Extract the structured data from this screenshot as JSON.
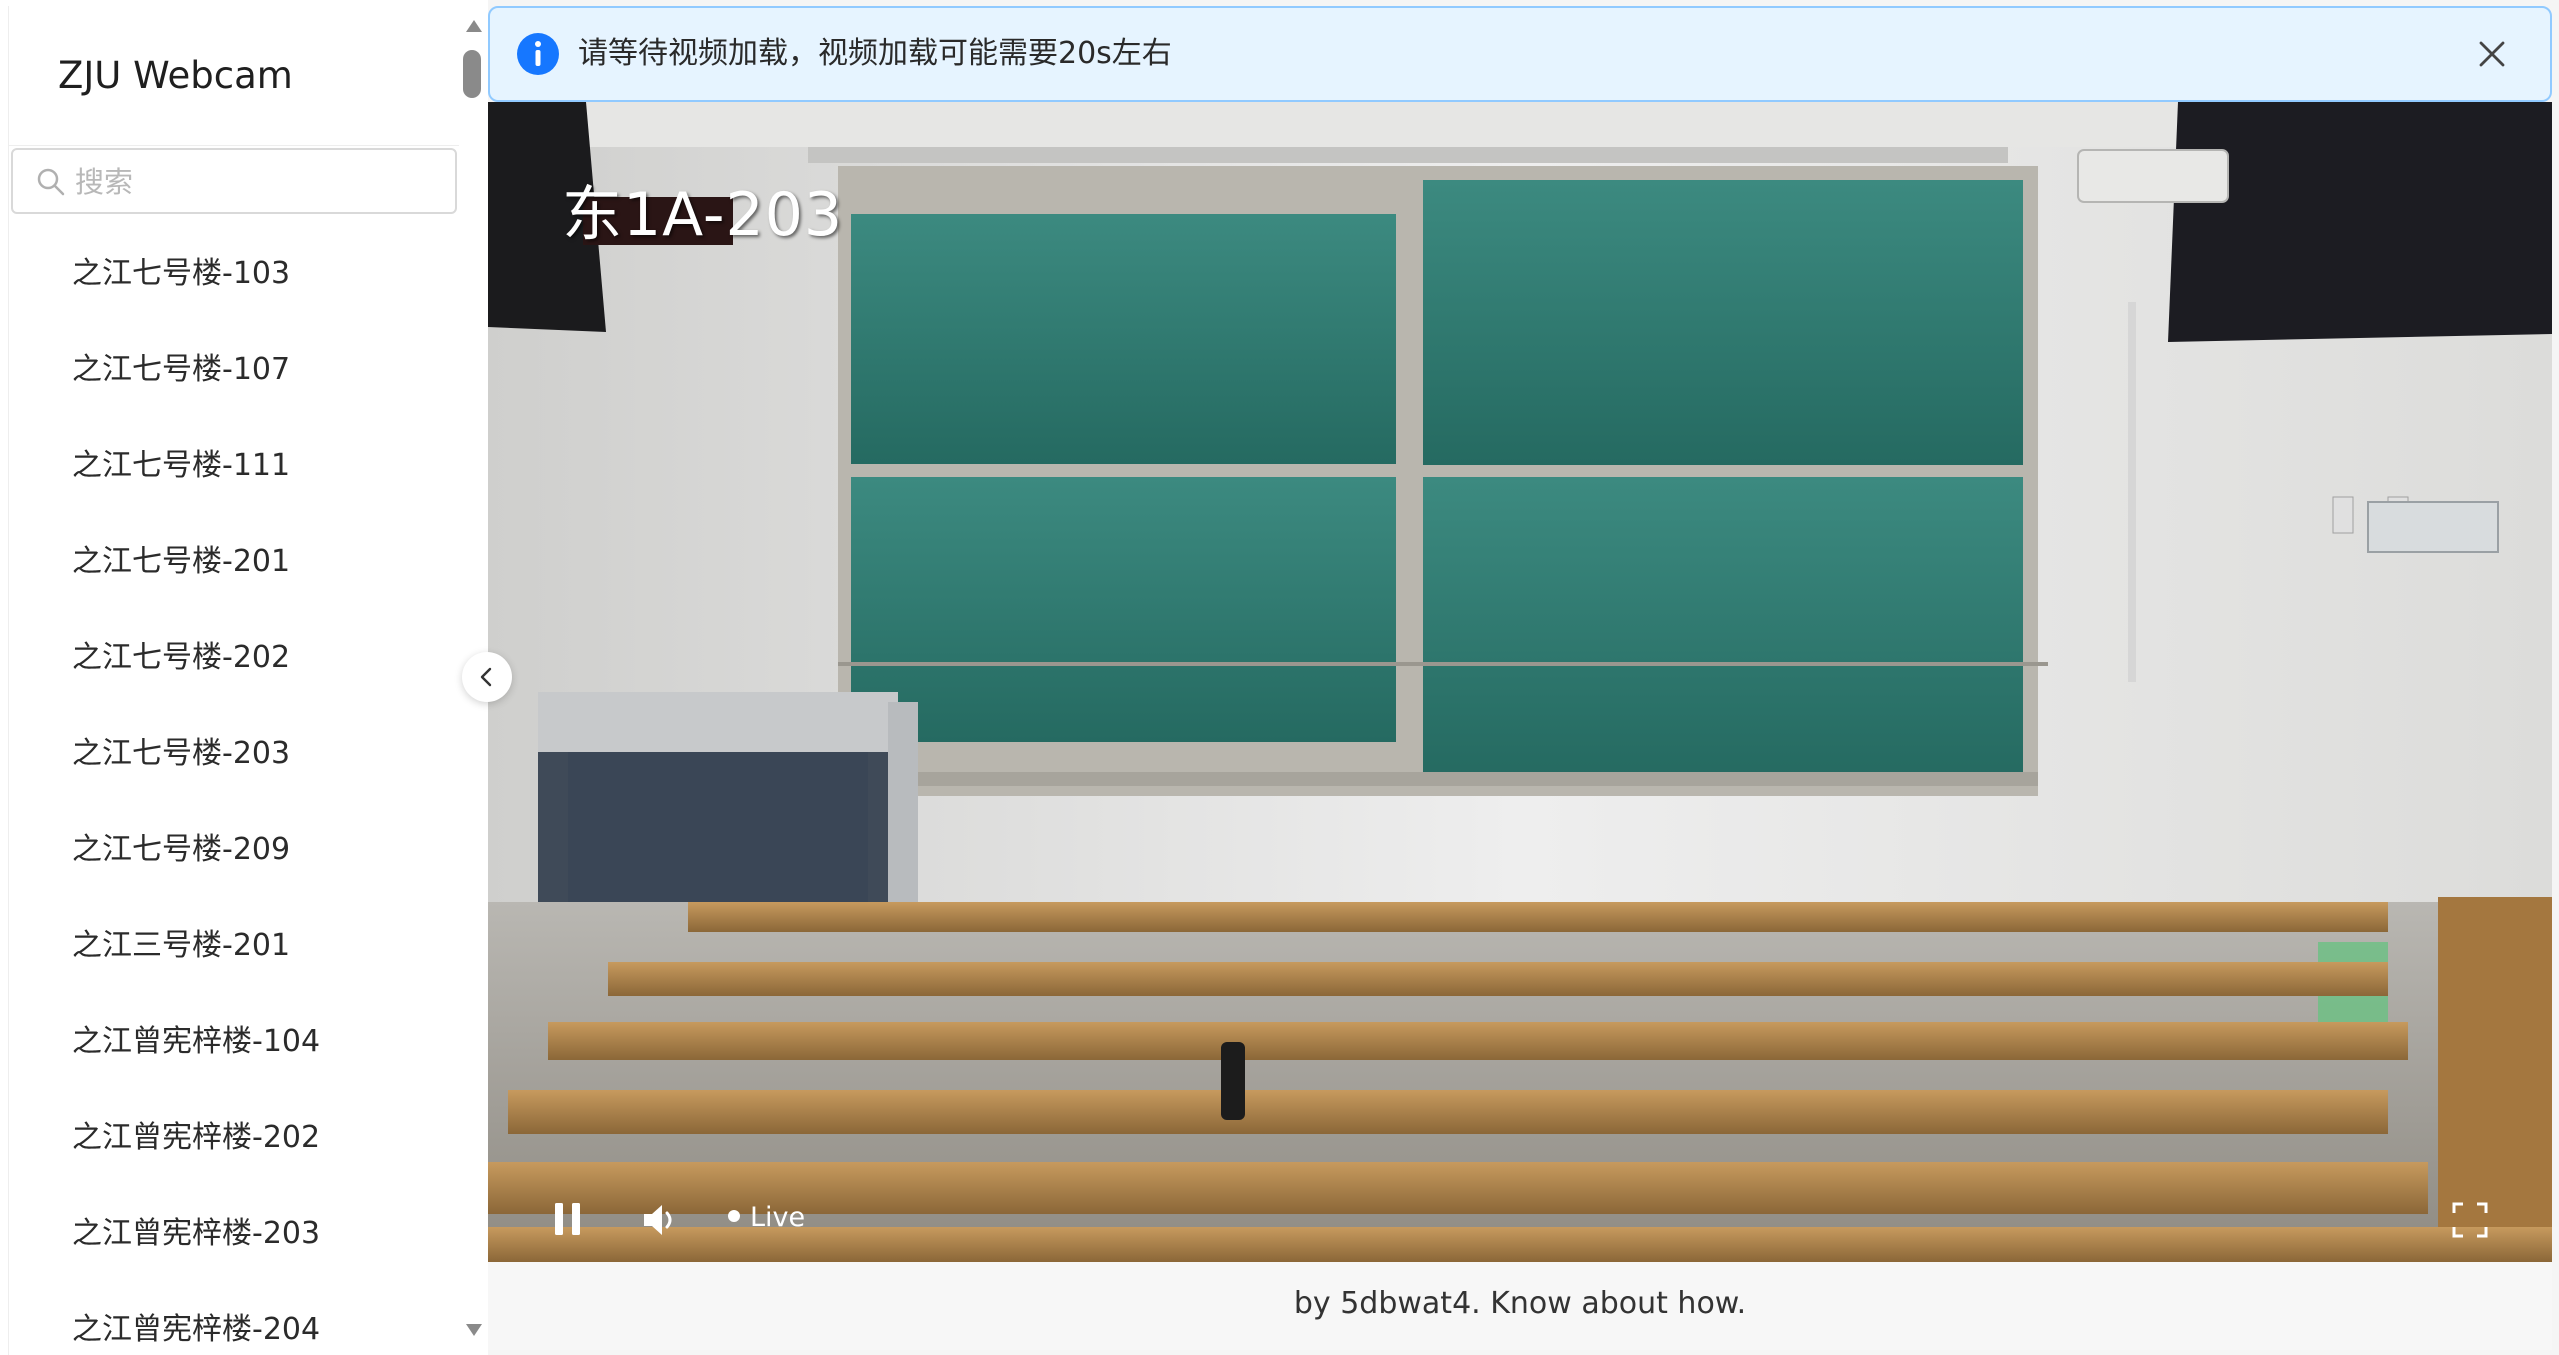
{
  "app": {
    "title": "ZJU Webcam"
  },
  "search": {
    "placeholder": "搜索"
  },
  "rooms": [
    {
      "label": "之江七号楼-103"
    },
    {
      "label": "之江七号楼-107"
    },
    {
      "label": "之江七号楼-111"
    },
    {
      "label": "之江七号楼-201"
    },
    {
      "label": "之江七号楼-202"
    },
    {
      "label": "之江七号楼-203"
    },
    {
      "label": "之江七号楼-209"
    },
    {
      "label": "之江三号楼-201"
    },
    {
      "label": "之江曾宪梓楼-104"
    },
    {
      "label": "之江曾宪梓楼-202"
    },
    {
      "label": "之江曾宪梓楼-203"
    },
    {
      "label": "之江曾宪梓楼-204"
    }
  ],
  "alert": {
    "message": "请等待视频加载，视频加载可能需要20s左右",
    "type": "info"
  },
  "player": {
    "room_overlay": "东1A-203",
    "live_label": "Live",
    "state": "playing"
  },
  "footer": {
    "text": "by 5dbwat4. Know about how."
  },
  "colors": {
    "alert_bg": "#e6f4ff",
    "alert_border": "#91caff",
    "info_icon": "#1677ff",
    "chalkboard": "#2f7d72"
  },
  "icons": {
    "search": "search-icon",
    "info": "info-icon",
    "close": "close-icon",
    "collapse": "chevron-left-icon",
    "pause": "pause-icon",
    "volume": "volume-icon",
    "fullscreen": "fullscreen-icon"
  }
}
